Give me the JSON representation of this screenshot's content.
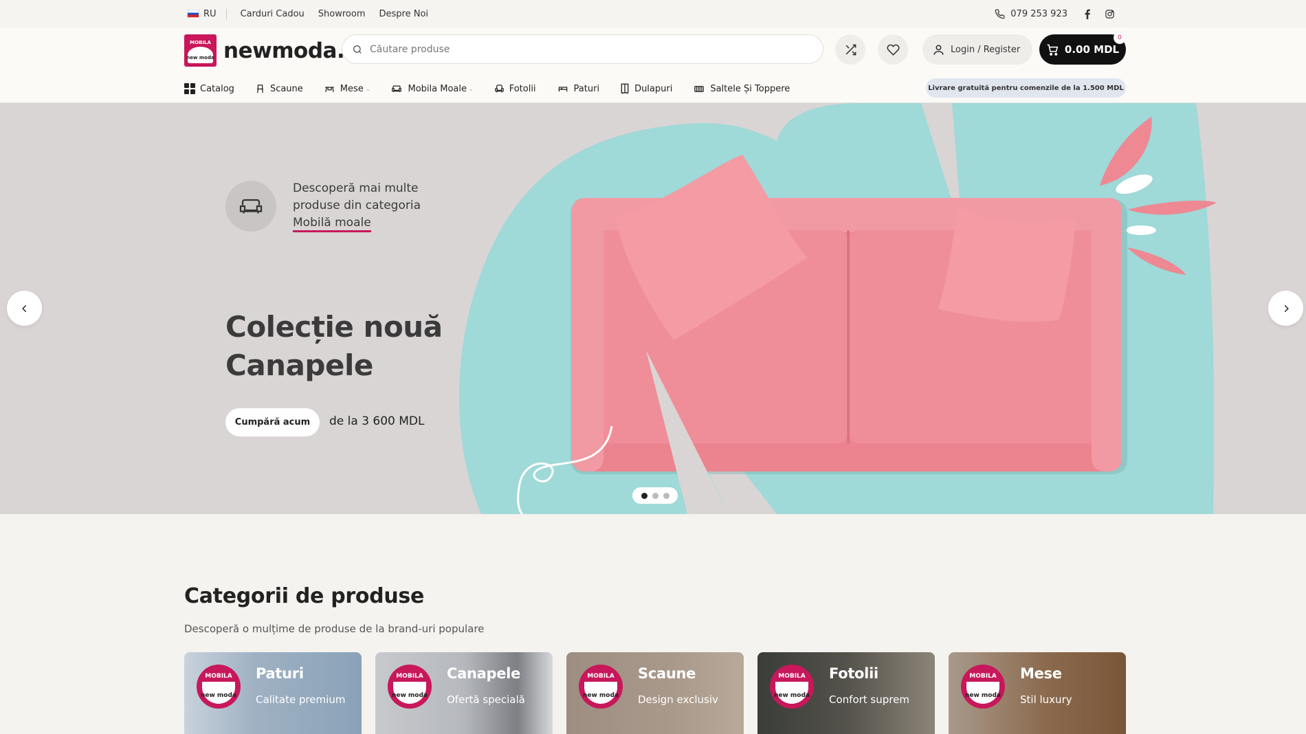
{
  "topbar": {
    "lang": "RU",
    "links": [
      "Carduri Cadou",
      "Showroom",
      "Despre Noi"
    ],
    "phone": "079 253 923"
  },
  "header": {
    "logo_badge_top": "MOBILA",
    "logo_badge_name": "new moda",
    "logo_text": "newmoda.",
    "search_placeholder": "Căutare produse",
    "login_label": "Login / Register",
    "cart_total": "0.00 MDL",
    "cart_count": "0"
  },
  "nav": {
    "items": [
      {
        "label": "Catalog",
        "icon": "catalog-grid-icon"
      },
      {
        "label": "Scaune",
        "icon": "chair-icon"
      },
      {
        "label": "Mese",
        "icon": "table-icon"
      },
      {
        "label": "Mobila Moale",
        "icon": "sofa-icon"
      },
      {
        "label": "Fotolii",
        "icon": "armchair-icon"
      },
      {
        "label": "Paturi",
        "icon": "bed-icon"
      },
      {
        "label": "Dulapuri",
        "icon": "wardrobe-icon"
      },
      {
        "label": "Saltele Și Toppere",
        "icon": "mattress-icon"
      }
    ],
    "promo": "Livrare gratuită pentru comenzile de la 1.500 MDL"
  },
  "hero": {
    "category_intro": "Descoperă mai multe produse din categoria",
    "category_link": "Mobilă moale",
    "title_line1": "Colecție nouă",
    "title_line2": "Canapele",
    "buy_label": "Cumpără acum",
    "price_from": "de la 3 600 MDL",
    "slides_total": 3,
    "active_slide": 1,
    "colors": {
      "background": "#d9d5d4",
      "blob": "#9fd9d8",
      "sofa": "#ee8893",
      "accent": "#c8175b"
    }
  },
  "categories": {
    "title": "Categorii de produse",
    "subtitle": "Descoperă o mulțime de produse de la brand-uri populare",
    "cards": [
      {
        "title": "Paturi",
        "subtitle": "Calitate premium"
      },
      {
        "title": "Canapele",
        "subtitle": "Ofertă specială"
      },
      {
        "title": "Scaune",
        "subtitle": "Design exclusiv"
      },
      {
        "title": "Fotolii",
        "subtitle": "Confort suprem"
      },
      {
        "title": "Mese",
        "subtitle": "Stil luxury"
      }
    ],
    "card_logo_top": "MOBILA",
    "card_logo_name": "new moda"
  }
}
